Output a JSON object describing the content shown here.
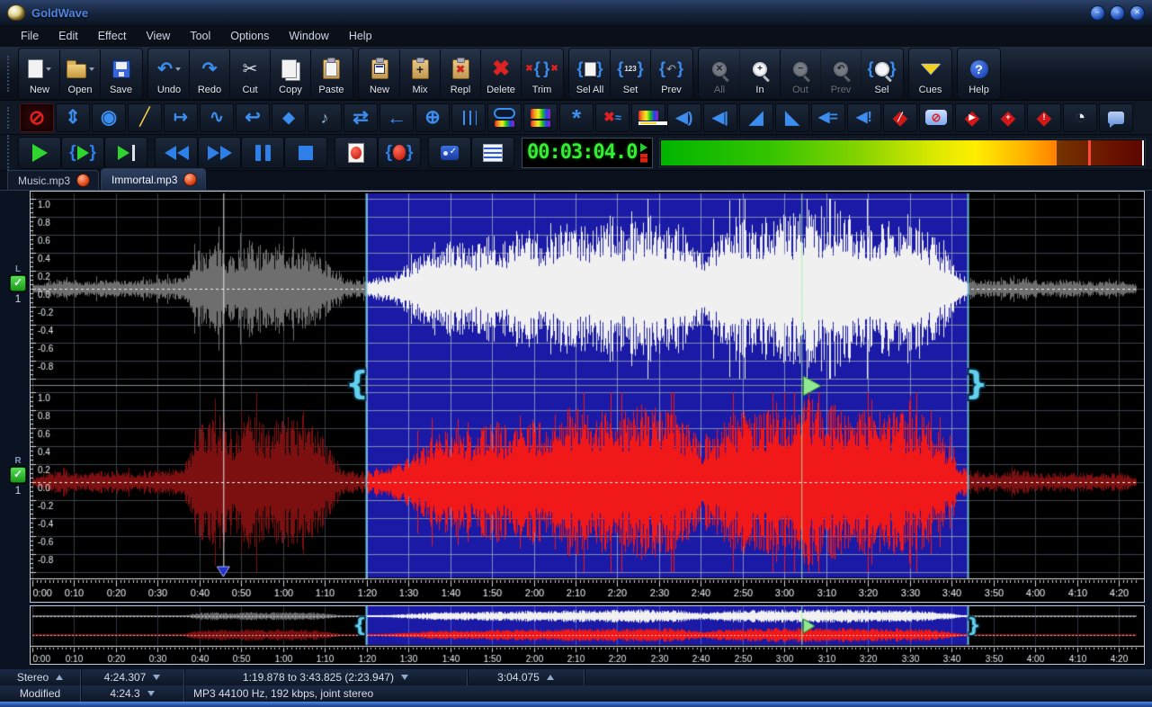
{
  "window": {
    "title": "GoldWave"
  },
  "menu": {
    "items": [
      "File",
      "Edit",
      "Effect",
      "View",
      "Tool",
      "Options",
      "Window",
      "Help"
    ]
  },
  "toolbar": {
    "groups": [
      {
        "name": "file",
        "buttons": [
          {
            "label": "New",
            "icon": "new-file-icon",
            "dropdown": true
          },
          {
            "label": "Open",
            "icon": "open-folder-icon",
            "dropdown": true
          },
          {
            "label": "Save",
            "icon": "save-floppy-icon"
          }
        ]
      },
      {
        "name": "edit",
        "buttons": [
          {
            "label": "Undo",
            "icon": "undo-icon",
            "dropdown": true
          },
          {
            "label": "Redo",
            "icon": "redo-icon"
          },
          {
            "label": "Cut",
            "icon": "cut-scissors-icon"
          },
          {
            "label": "Copy",
            "icon": "copy-icon"
          },
          {
            "label": "Paste",
            "icon": "paste-clipboard-icon"
          }
        ]
      },
      {
        "name": "paste-ops",
        "buttons": [
          {
            "label": "New",
            "icon": "paste-new-icon"
          },
          {
            "label": "Mix",
            "icon": "mix-icon"
          },
          {
            "label": "Repl",
            "icon": "replace-icon"
          },
          {
            "label": "Delete",
            "icon": "delete-x-icon"
          },
          {
            "label": "Trim",
            "icon": "trim-icon"
          }
        ]
      },
      {
        "name": "select",
        "buttons": [
          {
            "label": "Sel All",
            "icon": "select-all-icon"
          },
          {
            "label": "Set",
            "icon": "set-selection-icon"
          },
          {
            "label": "Prev",
            "icon": "previous-selection-icon"
          }
        ]
      },
      {
        "name": "zoom",
        "buttons": [
          {
            "label": "All",
            "icon": "zoom-all-icon",
            "disabled": true
          },
          {
            "label": "In",
            "icon": "zoom-in-icon"
          },
          {
            "label": "Out",
            "icon": "zoom-out-icon",
            "disabled": true
          },
          {
            "label": "Prev",
            "icon": "zoom-previous-icon",
            "disabled": true
          },
          {
            "label": "Sel",
            "icon": "zoom-selection-icon"
          }
        ]
      },
      {
        "name": "cues",
        "buttons": [
          {
            "label": "Cues",
            "icon": "cues-icon"
          }
        ]
      },
      {
        "name": "help",
        "buttons": [
          {
            "label": "Help",
            "icon": "help-icon"
          }
        ]
      }
    ]
  },
  "effects_toolbar": {
    "icons": [
      {
        "name": "disable-icon",
        "pressed": true
      },
      {
        "name": "volume-updown-icon"
      },
      {
        "name": "doppler-icon"
      },
      {
        "name": "shape-editor-icon"
      },
      {
        "name": "offset-icon"
      },
      {
        "name": "mechanize-icon"
      },
      {
        "name": "reverse-icon"
      },
      {
        "name": "flange-icon"
      },
      {
        "name": "pitch-icon"
      },
      {
        "name": "exchange-channels-icon"
      },
      {
        "name": "pan-left-icon"
      },
      {
        "name": "pan-icon"
      },
      {
        "name": "equalizer-icon"
      },
      {
        "name": "filter-icon"
      },
      {
        "name": "spectrum-icon"
      },
      {
        "name": "interpolate-icon"
      },
      {
        "name": "noise-reduction-icon"
      },
      {
        "name": "spectrum-filter-icon"
      },
      {
        "name": "speaker-icon"
      },
      {
        "name": "volume-fader-icon"
      },
      {
        "name": "fade-in-icon"
      },
      {
        "name": "fade-out-icon"
      },
      {
        "name": "volume-match-icon"
      },
      {
        "name": "volume-max-icon"
      },
      {
        "name": "shape-red-icon"
      },
      {
        "name": "censor-icon"
      },
      {
        "name": "expression-icon"
      },
      {
        "name": "effect-insert-icon"
      },
      {
        "name": "effect-info-icon"
      },
      {
        "name": "timer-icon"
      },
      {
        "name": "comment-icon"
      }
    ]
  },
  "transport": {
    "buttons": [
      {
        "name": "play-button",
        "icon": "play-icon"
      },
      {
        "name": "play-selection-button",
        "icon": "play-selection-icon"
      },
      {
        "name": "play-all-button",
        "icon": "play-all-icon"
      },
      {
        "name": "rewind-button",
        "icon": "rewind-icon"
      },
      {
        "name": "fast-forward-button",
        "icon": "fast-forward-icon"
      },
      {
        "name": "pause-button",
        "icon": "pause-icon"
      },
      {
        "name": "stop-button",
        "icon": "stop-icon"
      },
      {
        "name": "record-button",
        "icon": "record-icon"
      },
      {
        "name": "record-selection-button",
        "icon": "record-selection-icon"
      },
      {
        "name": "monitor-button",
        "icon": "monitor-icon"
      },
      {
        "name": "control-properties-button",
        "icon": "control-properties-icon"
      }
    ],
    "time_display": "00:03:04.0",
    "meter": {
      "level_percent": 82,
      "peak_percent": 88.5
    }
  },
  "tabs": [
    {
      "label": "Music.mp3",
      "active": false
    },
    {
      "label": "Immortal.mp3",
      "active": true
    }
  ],
  "editor": {
    "duration_seconds": 264.307,
    "selection": {
      "start_seconds": 79.878,
      "end_seconds": 223.825
    },
    "playback_seconds": 184.075,
    "cue_seconds": 45.7,
    "time_tick_interval_seconds": 10,
    "amplitude_ticks": [
      "1.0",
      "0.8",
      "0.6",
      "0.4",
      "0.2",
      "0.0",
      "-0.2",
      "-0.4",
      "-0.6",
      "-0.8"
    ],
    "channels": [
      {
        "label": "L",
        "number": "1"
      },
      {
        "label": "R",
        "number": "1"
      }
    ],
    "envelope_L": [
      [
        0,
        0.05
      ],
      [
        6,
        0.11
      ],
      [
        12,
        0.08
      ],
      [
        18,
        0.11
      ],
      [
        24,
        0.09
      ],
      [
        30,
        0.12
      ],
      [
        36,
        0.13
      ],
      [
        40,
        0.45
      ],
      [
        44,
        0.52
      ],
      [
        48,
        0.4
      ],
      [
        52,
        0.55
      ],
      [
        56,
        0.45
      ],
      [
        60,
        0.52
      ],
      [
        64,
        0.48
      ],
      [
        68,
        0.42
      ],
      [
        71,
        0.28
      ],
      [
        74,
        0.12
      ],
      [
        78,
        0.1
      ],
      [
        82,
        0.12
      ],
      [
        86,
        0.18
      ],
      [
        90,
        0.3
      ],
      [
        94,
        0.42
      ],
      [
        98,
        0.5
      ],
      [
        102,
        0.55
      ],
      [
        106,
        0.48
      ],
      [
        110,
        0.62
      ],
      [
        114,
        0.55
      ],
      [
        118,
        0.68
      ],
      [
        122,
        0.6
      ],
      [
        126,
        0.72
      ],
      [
        130,
        0.78
      ],
      [
        134,
        0.7
      ],
      [
        138,
        0.82
      ],
      [
        142,
        0.74
      ],
      [
        146,
        0.85
      ],
      [
        150,
        0.76
      ],
      [
        154,
        0.8
      ],
      [
        157,
        0.6
      ],
      [
        160,
        0.42
      ],
      [
        163,
        0.55
      ],
      [
        166,
        0.7
      ],
      [
        170,
        0.8
      ],
      [
        174,
        0.76
      ],
      [
        178,
        0.86
      ],
      [
        182,
        0.8
      ],
      [
        186,
        0.9
      ],
      [
        190,
        0.82
      ],
      [
        194,
        0.86
      ],
      [
        198,
        0.8
      ],
      [
        202,
        0.76
      ],
      [
        206,
        0.8
      ],
      [
        210,
        0.74
      ],
      [
        214,
        0.68
      ],
      [
        217,
        0.52
      ],
      [
        220,
        0.34
      ],
      [
        222,
        0.18
      ],
      [
        225,
        0.1
      ],
      [
        230,
        0.09
      ],
      [
        236,
        0.12
      ],
      [
        242,
        0.09
      ],
      [
        248,
        0.11
      ],
      [
        254,
        0.08
      ],
      [
        260,
        0.1
      ],
      [
        264.3,
        0.05
      ]
    ],
    "envelope_R": [
      [
        0,
        0.06
      ],
      [
        6,
        0.13
      ],
      [
        12,
        0.1
      ],
      [
        18,
        0.13
      ],
      [
        24,
        0.11
      ],
      [
        30,
        0.14
      ],
      [
        36,
        0.16
      ],
      [
        40,
        0.65
      ],
      [
        44,
        0.78
      ],
      [
        48,
        0.58
      ],
      [
        52,
        0.8
      ],
      [
        56,
        0.62
      ],
      [
        60,
        0.76
      ],
      [
        64,
        0.7
      ],
      [
        68,
        0.6
      ],
      [
        71,
        0.4
      ],
      [
        74,
        0.15
      ],
      [
        78,
        0.12
      ],
      [
        82,
        0.14
      ],
      [
        86,
        0.2
      ],
      [
        90,
        0.34
      ],
      [
        94,
        0.48
      ],
      [
        98,
        0.56
      ],
      [
        102,
        0.62
      ],
      [
        106,
        0.55
      ],
      [
        110,
        0.7
      ],
      [
        114,
        0.62
      ],
      [
        118,
        0.76
      ],
      [
        122,
        0.68
      ],
      [
        126,
        0.8
      ],
      [
        130,
        0.85
      ],
      [
        134,
        0.76
      ],
      [
        138,
        0.88
      ],
      [
        142,
        0.8
      ],
      [
        146,
        0.9
      ],
      [
        150,
        0.82
      ],
      [
        154,
        0.86
      ],
      [
        157,
        0.66
      ],
      [
        160,
        0.48
      ],
      [
        163,
        0.6
      ],
      [
        166,
        0.76
      ],
      [
        170,
        0.85
      ],
      [
        174,
        0.8
      ],
      [
        178,
        0.9
      ],
      [
        182,
        0.85
      ],
      [
        186,
        0.94
      ],
      [
        190,
        0.86
      ],
      [
        194,
        0.9
      ],
      [
        198,
        0.84
      ],
      [
        202,
        0.8
      ],
      [
        206,
        0.84
      ],
      [
        210,
        0.78
      ],
      [
        214,
        0.72
      ],
      [
        217,
        0.56
      ],
      [
        220,
        0.38
      ],
      [
        222,
        0.2
      ],
      [
        225,
        0.12
      ],
      [
        230,
        0.1
      ],
      [
        236,
        0.14
      ],
      [
        242,
        0.1
      ],
      [
        248,
        0.12
      ],
      [
        254,
        0.09
      ],
      [
        260,
        0.11
      ],
      [
        264.3,
        0.06
      ]
    ]
  },
  "colors": {
    "selection_fill": "#1a1aa6",
    "wave_left": "#f0f0f0",
    "wave_left_dim": "#6e6e6e",
    "wave_right": "#f01818",
    "wave_right_dim": "#7c1010",
    "playback_marker": "#90e890",
    "selection_handle": "#62d0ec",
    "grid": "#3f444d",
    "grid_selection": "#9096c0",
    "background": "#000000"
  },
  "status_bar_1": {
    "channels": "Stereo",
    "length": "4:24.307",
    "selection": "1:19.878 to 3:43.825 (2:23.947)",
    "position": "3:04.075"
  },
  "status_bar_2": {
    "state": "Modified",
    "length": "4:24.3",
    "format": "MP3 44100 Hz, 192 kbps, joint stereo"
  }
}
